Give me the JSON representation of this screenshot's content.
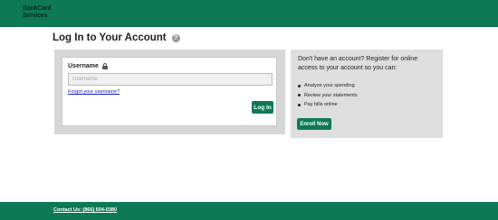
{
  "header": {
    "logo_line1": "BankCard",
    "logo_line2": "Services"
  },
  "title": "Log In to Your Account",
  "help_icon": "question-circle-icon",
  "login": {
    "username_label": "Username",
    "username_placeholder": "Username",
    "username_value": "",
    "forgot_link": "Forgot your username?",
    "login_button": "Log In"
  },
  "register": {
    "text": "Don't have an account? Register for online access to your account so you can:",
    "benefits": [
      "Analyze your spending",
      "Review your statements",
      "Pay bills online"
    ],
    "enroll_button": "Enroll Now"
  },
  "footer": {
    "contact": "Contact Us: (866) 604-0380"
  },
  "colors": {
    "brand_green": "#0e7a55",
    "panel_gray": "#d7d7d7",
    "link_blue": "#1a1ab8"
  }
}
